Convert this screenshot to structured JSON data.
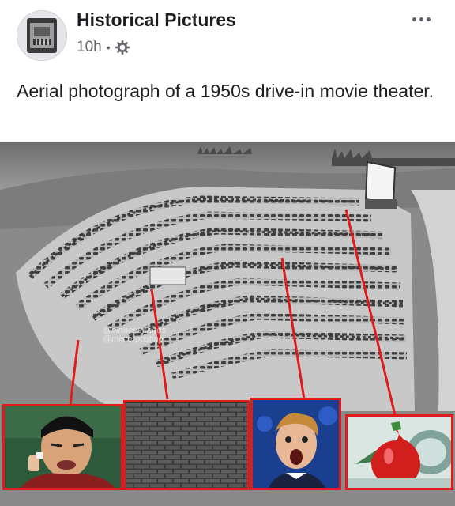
{
  "post": {
    "page_name": "Historical Pictures",
    "time": "10h",
    "separator": "•",
    "caption": "Aerial photograph of a 1950s drive-in movie theater."
  },
  "icons": {
    "avatar": "historical-pictures-logo",
    "privacy": "gear-icon",
    "menu": "more-options-icon"
  },
  "image": {
    "description_tags": [
      "aerial drive-in theater",
      "movie screen",
      "parked cars rows"
    ],
    "watermark": [
      "@dinner.images",
      "@misterposting"
    ],
    "insets": [
      {
        "name": "squinting-man-meme",
        "border_color": "#e01b1b"
      },
      {
        "name": "brick-wall",
        "border_color": "#e01b1b"
      },
      {
        "name": "shocked-boy-meme",
        "border_color": "#e01b1b"
      },
      {
        "name": "red-ornament-cartoon",
        "border_color": "#e01b1b"
      }
    ]
  },
  "colors": {
    "text_primary": "#1c1e21",
    "text_secondary": "#65676b",
    "annotation_red": "#e01b1b"
  }
}
